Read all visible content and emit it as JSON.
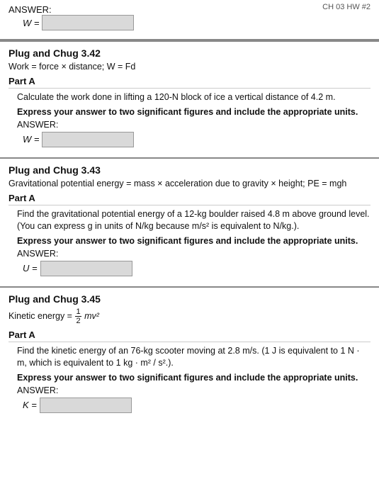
{
  "header": {
    "course_label": "CH 03 HW #2",
    "answer_label": "ANSWER:",
    "var_w": "W ="
  },
  "section1": {
    "title": "Plug and Chug 3.42",
    "formula": "Work = force × distance; W = Fd",
    "part": "Part A",
    "problem": "Calculate the work done in lifting a 120-N block of ice a vertical distance of 4.2 m.",
    "sig_figs": "Express your answer to two significant figures and include the appropriate units.",
    "answer_label": "ANSWER:",
    "var": "W ="
  },
  "section2": {
    "title": "Plug and Chug 3.43",
    "formula": "Gravitational potential energy = mass × acceleration due to gravity × height; PE = mgh",
    "part": "Part A",
    "problem": "Find the gravitational potential energy of a 12-kg boulder raised 4.8 m above ground level. (You can express g in units of N/kg because m/s² is equivalent to N/kg.).",
    "sig_figs": "Express your answer to two significant figures and include the appropriate units.",
    "answer_label": "ANSWER:",
    "var": "U ="
  },
  "section3": {
    "title": "Plug and Chug 3.45",
    "formula_prefix": "Kinetic energy = ",
    "formula_frac_num": "1",
    "formula_frac_den": "2",
    "formula_suffix": "mv²",
    "part": "Part A",
    "problem": "Find the kinetic energy of an 76-kg scooter moving at 2.8 m/s. (1 J is equivalent to 1 N · m, which is equivalent to 1 kg · m² / s².).",
    "sig_figs": "Express your answer to two significant figures and include the appropriate units.",
    "answer_label": "ANSWER:",
    "var": "K ="
  }
}
